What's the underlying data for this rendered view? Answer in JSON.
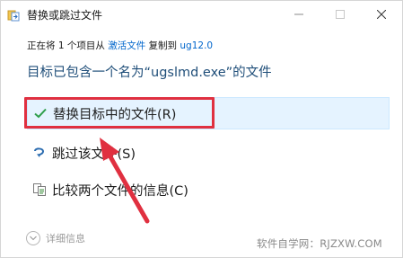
{
  "window": {
    "title": "替换或跳过文件"
  },
  "info": {
    "prefix": "正在将 1 个项目从 ",
    "source": "激活文件",
    "middle": " 复制到 ",
    "dest": "ug12.0"
  },
  "heading": "目标已包含一个名为“ugslmd.exe”的文件",
  "options": [
    {
      "label": "替换目标中的文件(R)"
    },
    {
      "label": "跳过该文件(S)"
    },
    {
      "label": "比较两个文件的信息(C)"
    }
  ],
  "footer": {
    "details_label": "详细信息",
    "watermark": "软件自学网：RJZXW.COM"
  },
  "colors": {
    "accent": "#0066cc",
    "highlight": "#e5f3ff",
    "annotation_red": "#e03040"
  }
}
